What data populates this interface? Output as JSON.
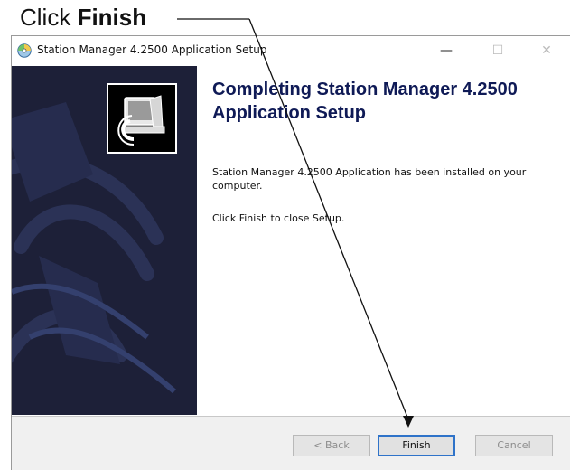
{
  "callout": {
    "prefix": "Click ",
    "emphasis": "Finish"
  },
  "window": {
    "title": "Station Manager 4.2500 Application Setup",
    "icon": "installer-disc-icon",
    "controls": {
      "minimize": "—",
      "maximize": "☐",
      "close": "✕"
    }
  },
  "banner": {
    "logo": "computer-install-icon",
    "colors": {
      "background": "#1d2038"
    }
  },
  "content": {
    "heading": "Completing Station Manager 4.2500 Application Setup",
    "installed_text": "Station Manager 4.2500 Application has been installed on your computer.",
    "instruction_text": "Click Finish to close Setup."
  },
  "footer": {
    "back_label": "< Back",
    "finish_label": "Finish",
    "cancel_label": "Cancel"
  },
  "colors": {
    "heading": "#0f1a56",
    "default_button_border": "#2f73c9"
  }
}
